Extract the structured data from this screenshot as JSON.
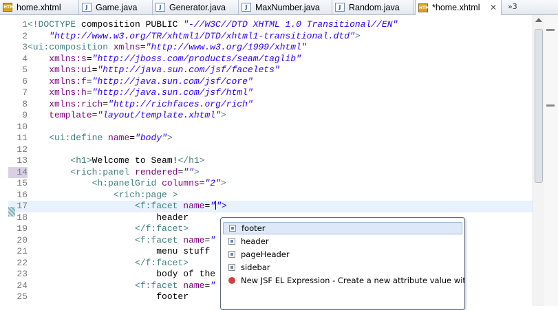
{
  "tabs": [
    {
      "label": "home.xhtml",
      "icon": "xhtml-file-icon",
      "active": false
    },
    {
      "label": "Game.java",
      "icon": "java-file-icon",
      "active": false
    },
    {
      "label": "Generator.java",
      "icon": "java-file-icon",
      "active": false
    },
    {
      "label": "MaxNumber.java",
      "icon": "java-file-icon",
      "active": false
    },
    {
      "label": "Random.java",
      "icon": "java-file-icon",
      "active": false
    },
    {
      "label": "*home.xhtml",
      "icon": "xhtml-file-icon",
      "active": true
    }
  ],
  "tab_close_glyph": "✕",
  "overflow_indicator": "»3",
  "editor": {
    "current_line": 17,
    "lines": [
      {
        "n": "1",
        "text": "<!DOCTYPE composition PUBLIC \"-//W3C//DTD XHTML 1.0 Transitional//EN\""
      },
      {
        "n": "2",
        "text": "    \"http://www.w3.org/TR/xhtml1/DTD/xhtml1-transitional.dtd\">"
      },
      {
        "n": "3",
        "text": "<ui:composition xmlns=\"http://www.w3.org/1999/xhtml\""
      },
      {
        "n": "4",
        "text": "    xmlns:s=\"http://jboss.com/products/seam/taglib\""
      },
      {
        "n": "5",
        "text": "    xmlns:ui=\"http://java.sun.com/jsf/facelets\""
      },
      {
        "n": "6",
        "text": "    xmlns:f=\"http://java.sun.com/jsf/core\""
      },
      {
        "n": "7",
        "text": "    xmlns:h=\"http://java.sun.com/jsf/html\""
      },
      {
        "n": "8",
        "text": "    xmlns:rich=\"http://richfaces.org/rich\""
      },
      {
        "n": "9",
        "text": "    template=\"layout/template.xhtml\">"
      },
      {
        "n": "10",
        "text": ""
      },
      {
        "n": "11",
        "text": "    <ui:define name=\"body\">"
      },
      {
        "n": "12",
        "text": ""
      },
      {
        "n": "13",
        "text": "        <h1>Welcome to Seam!</h1>"
      },
      {
        "n": "14",
        "text": "        <rich:panel rendered=\"\">"
      },
      {
        "n": "15",
        "text": "            <h:panelGrid columns=\"2\">"
      },
      {
        "n": "16",
        "text": "                <rich:page >"
      },
      {
        "n": "17",
        "text": "                    <f:facet name=\"\">"
      },
      {
        "n": "18",
        "text": "                        header"
      },
      {
        "n": "19",
        "text": "                    </f:facet>"
      },
      {
        "n": "20",
        "text": "                    <f:facet name=\""
      },
      {
        "n": "21",
        "text": "                        menu stuff"
      },
      {
        "n": "22",
        "text": "                    </f:facet>"
      },
      {
        "n": "23",
        "text": "                        body of the"
      },
      {
        "n": "24",
        "text": "                    <f:facet name=\""
      },
      {
        "n": "25",
        "text": "                        footer"
      }
    ]
  },
  "content_assist": {
    "items": [
      {
        "label": "footer",
        "icon": "attribute-value-icon",
        "selected": true
      },
      {
        "label": "header",
        "icon": "attribute-value-icon",
        "selected": false
      },
      {
        "label": "pageHeader",
        "icon": "attribute-value-icon",
        "selected": false
      },
      {
        "label": "sidebar",
        "icon": "attribute-value-icon",
        "selected": false
      },
      {
        "label": "New JSF EL Expression - Create a new attribute value with #{}",
        "icon": "el-expression-icon",
        "selected": false
      }
    ]
  },
  "colors": {
    "tag": "#3f7f7f",
    "attribute": "#7f007f",
    "string": "#2a00ff",
    "current_line": "#e8f2fe"
  }
}
